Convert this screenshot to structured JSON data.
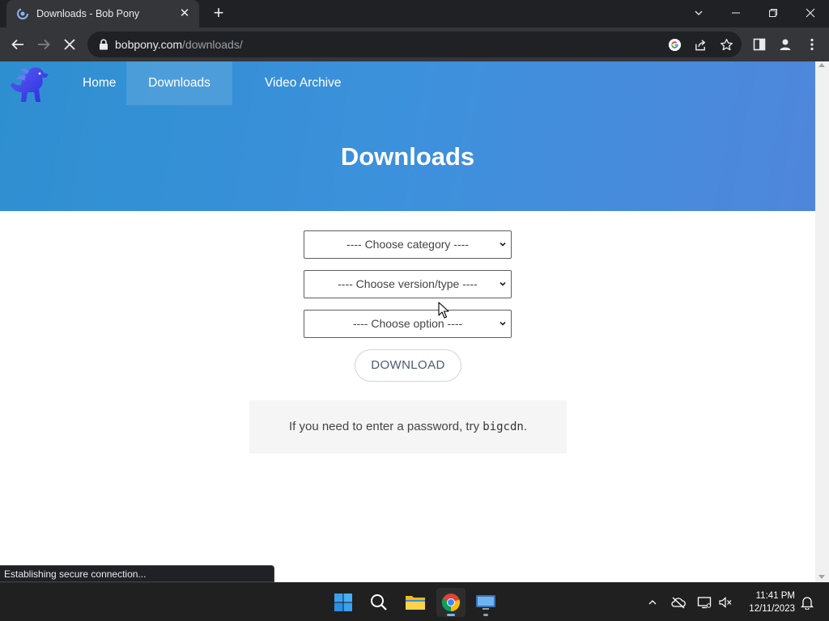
{
  "browser": {
    "tab_title": "Downloads - Bob Pony",
    "new_tab": "+",
    "url_host": "bobpony.com",
    "url_path": "/downloads/",
    "status_text": "Establishing secure connection..."
  },
  "site": {
    "nav": [
      "Home",
      "Downloads",
      "Video Archive"
    ],
    "hero_title": "Downloads",
    "selects": {
      "category": "---- Choose category ----",
      "version": "---- Choose version/type ----",
      "option": "---- Choose option ----"
    },
    "download_label": "DOWNLOAD",
    "note_prefix": "If you need to enter a password, try ",
    "note_code": "bigcdn",
    "note_suffix": "."
  },
  "taskbar": {
    "time": "11:41 PM",
    "date": "12/11/2023"
  },
  "colors": {
    "hero_start": "#2e8fd0",
    "hero_end": "#4f86dc",
    "chrome_dark": "#202124",
    "chrome_toolbar": "#35363a"
  }
}
